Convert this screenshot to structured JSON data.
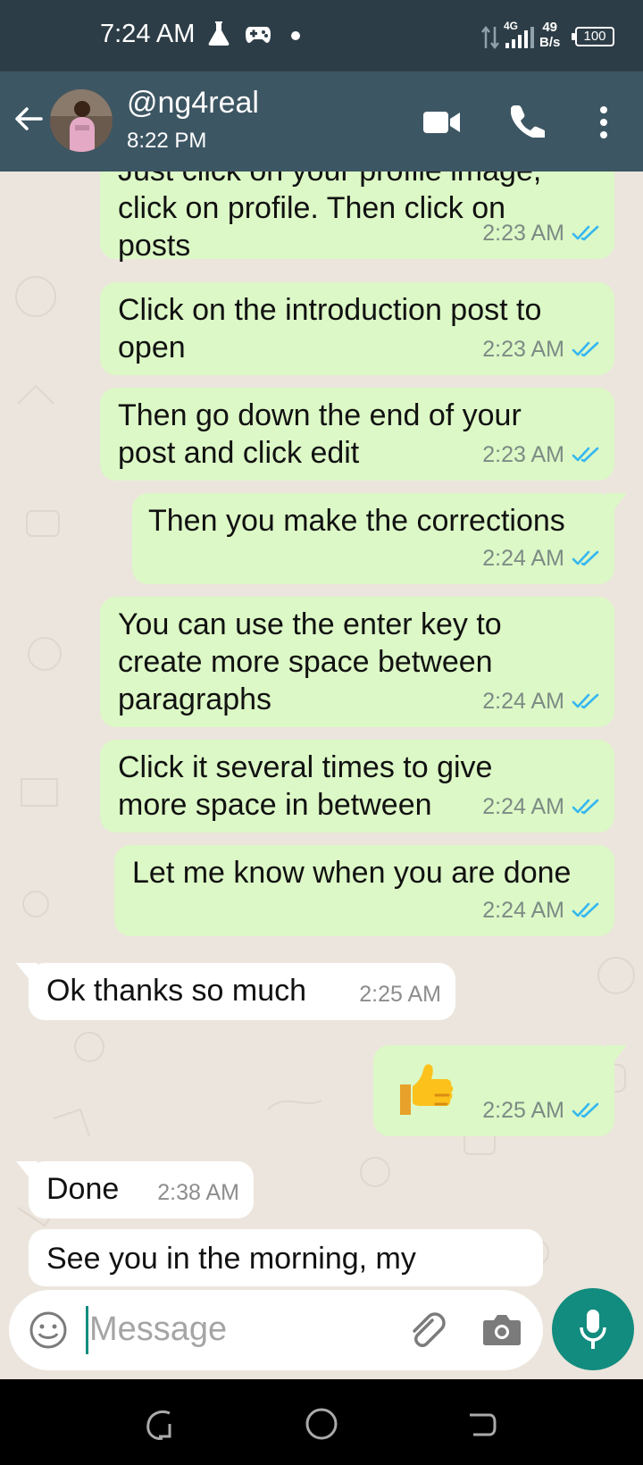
{
  "status_bar": {
    "time": "7:24 AM",
    "network": "4G",
    "speed_value": "49",
    "speed_unit": "B/s",
    "battery": "100"
  },
  "header": {
    "contact_name": "@ng4real",
    "status": "8:22 PM"
  },
  "messages": [
    {
      "dir": "out",
      "text": "Just click on your profile  image, click on profile. Then click on posts",
      "time": "2:23 AM"
    },
    {
      "dir": "out",
      "text": "Click on the introduction post to open",
      "time": "2:23 AM"
    },
    {
      "dir": "out",
      "text": "Then go down the end of your post and click edit",
      "time": "2:23 AM"
    },
    {
      "dir": "out",
      "text": "Then you make the corrections",
      "time": "2:24 AM"
    },
    {
      "dir": "out",
      "text": "You can use the enter key to create more space between paragraphs",
      "time": "2:24 AM"
    },
    {
      "dir": "out",
      "text": "Click it several times to give more space in between",
      "time": "2:24 AM"
    },
    {
      "dir": "out",
      "text": "Let me know when you are done",
      "time": "2:24 AM"
    },
    {
      "dir": "in",
      "text": "Ok thanks so much",
      "time": "2:25 AM"
    },
    {
      "dir": "out",
      "text": "👍",
      "time": "2:25 AM"
    },
    {
      "dir": "in",
      "text": "Done",
      "time": "2:38 AM"
    },
    {
      "dir": "in",
      "text": "See you in the morning, my",
      "time": ""
    }
  ],
  "input": {
    "placeholder": "Message",
    "value": ""
  },
  "colors": {
    "header": "#3d5663",
    "status_bar": "#2d3d47",
    "outgoing_bubble": "#dcf8c6",
    "incoming_bubble": "#ffffff",
    "accent": "#128c7e",
    "read_ticks": "#34b7f1"
  },
  "icons": [
    "back-arrow-icon",
    "video-call-icon",
    "phone-icon",
    "more-options-icon",
    "emoji-icon",
    "attach-icon",
    "camera-icon",
    "mic-icon",
    "double-chevron-down-icon",
    "read-ticks-icon",
    "thumbs-up-emoji"
  ]
}
